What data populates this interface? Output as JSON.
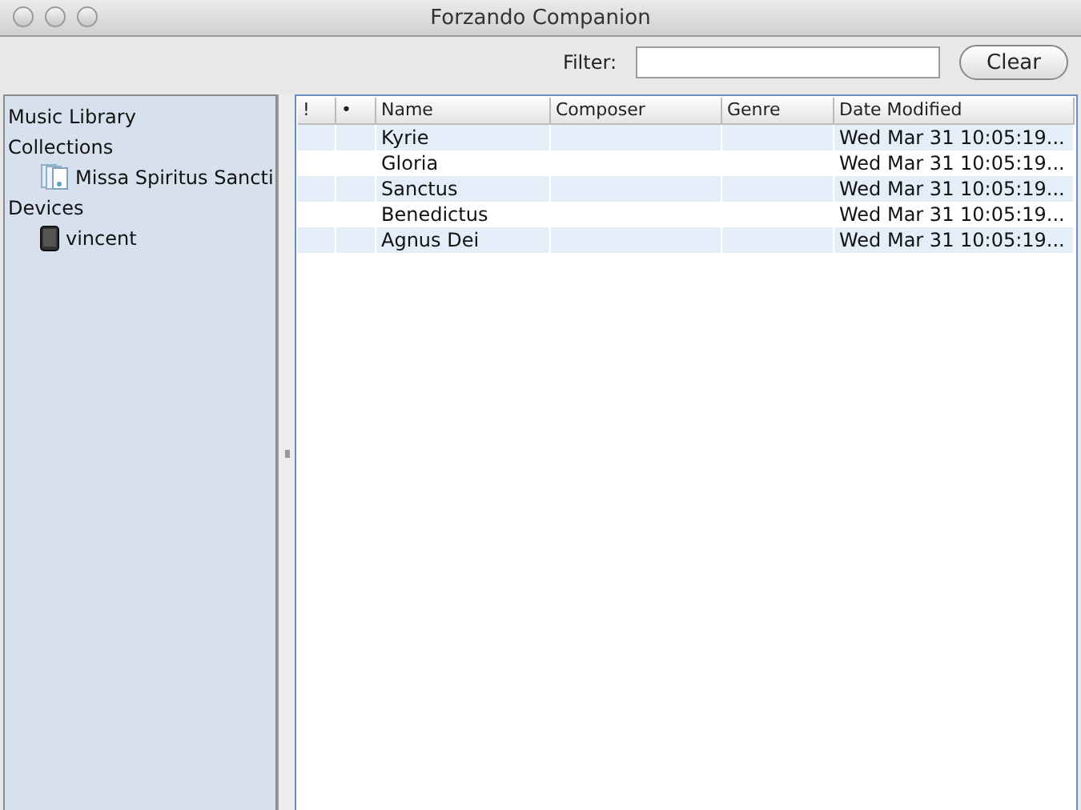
{
  "window": {
    "title": "Forzando Companion"
  },
  "toolbar": {
    "filter_label": "Filter:",
    "clear_button": "Clear"
  },
  "sidebar": {
    "items": [
      {
        "label": "Music Library"
      },
      {
        "label": "Collections",
        "children": [
          {
            "label": "Missa Spiritus Sancti",
            "kind": "collection"
          }
        ]
      },
      {
        "label": "Devices",
        "children": [
          {
            "label": "vincent",
            "kind": "device"
          }
        ]
      }
    ]
  },
  "table": {
    "columns": [
      "!",
      "•",
      "Name",
      "Composer",
      "Genre",
      "Date Modified"
    ],
    "rows": [
      [
        null,
        null,
        "Kyrie",
        null,
        null,
        "Wed Mar 31 10:05:19..."
      ],
      [
        null,
        null,
        "Gloria",
        null,
        null,
        "Wed Mar 31 10:05:19..."
      ],
      [
        null,
        null,
        "Sanctus",
        null,
        null,
        "Wed Mar 31 10:05:19..."
      ],
      [
        null,
        null,
        "Benedictus",
        null,
        null,
        "Wed Mar 31 10:05:19..."
      ],
      [
        null,
        null,
        "Agnus Dei",
        null,
        null,
        "Wed Mar 31 10:05:19..."
      ]
    ]
  }
}
